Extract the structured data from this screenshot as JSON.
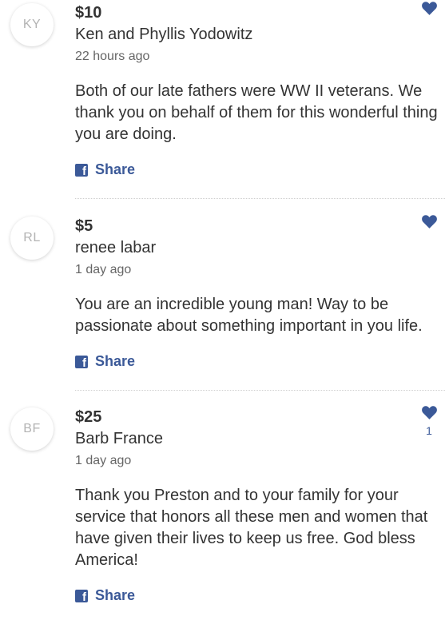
{
  "donations": [
    {
      "initials": "KY",
      "amount": "$10",
      "name": "Ken and Phyllis Yodowitz",
      "time": "22 hours ago",
      "comment": "Both of our late fathers were WW II veterans. We thank you on behalf of them for this wonderful thing you are doing.",
      "share_label": "Share",
      "likes": ""
    },
    {
      "initials": "RL",
      "amount": "$5",
      "name": "renee labar",
      "time": "1 day ago",
      "comment": "You are an incredible young man! Way to be passionate about something important in you life.",
      "share_label": "Share",
      "likes": ""
    },
    {
      "initials": "BF",
      "amount": "$25",
      "name": "Barb France",
      "time": "1 day ago",
      "comment": "Thank you Preston and to your family for your service that honors all these men and women that have given their lives to keep us free. God bless America!",
      "share_label": "Share",
      "likes": "1"
    }
  ],
  "icons": {
    "like": "heart-icon",
    "share": "facebook-icon"
  },
  "colors": {
    "accent": "#3b5998",
    "text": "#333333",
    "muted": "#666666",
    "avatar_text": "#b3b3b3"
  }
}
